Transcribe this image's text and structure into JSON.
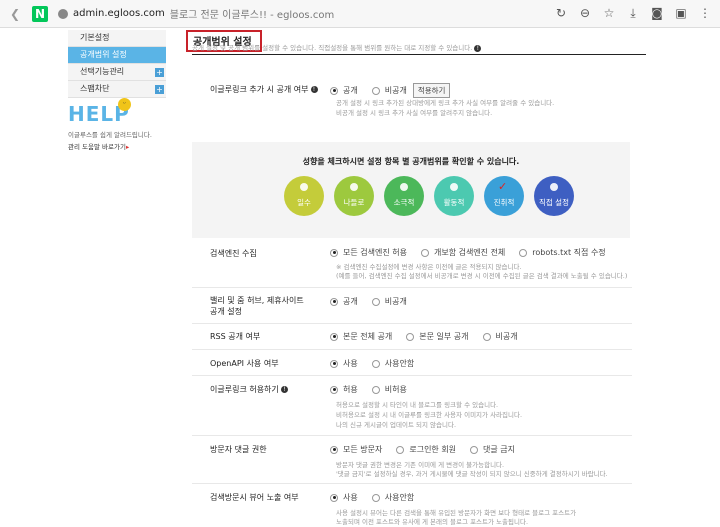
{
  "browser": {
    "logo_letter": "N",
    "url_domain": "admin.egloos.com",
    "url_title": "블로그 전문 이글루스!! - egloos.com"
  },
  "sidebar": {
    "items": [
      {
        "label": "기본설정",
        "active": false,
        "plus": false
      },
      {
        "label": "공개범위 설정",
        "active": true,
        "plus": false
      },
      {
        "label": "선택기능관리",
        "active": false,
        "plus": true
      },
      {
        "label": "스팸차단",
        "active": false,
        "plus": true
      }
    ],
    "plus_glyph": "+"
  },
  "help": {
    "title": "HELP",
    "smile": "ᵕ",
    "line1": "이글루스를 쉽게 알려드립니다.",
    "line2": "관리 도움말 바로가기",
    "arrow": "▸"
  },
  "main": {
    "title": "공개범위 설정",
    "desc": "공개 설정 및 공개 범위를 설정할 수 있습니다. 직접설정을 통해 범위를 원하는 대로 지정할 수 있습니다.",
    "trackback": {
      "label": "이글루링크 추가 시 공개 여부",
      "opt1": "공개",
      "opt2": "비공개",
      "apply": "적용하기",
      "note1": "공개 설정 시 링크 추가된 상대방에게 링크 추가 사실 여부를 알려줄 수 있습니다.",
      "note2": "비공개 설정 시 링크 추가 사실 여부를 알려주지 않습니다."
    },
    "persona": {
      "title": "성향을 체크하시면 설정 항목 별 공개범위를 확인할 수 있습니다.",
      "items": [
        {
          "label": "일수",
          "color": "#c4cc3a"
        },
        {
          "label": "나들로",
          "color": "#9dc93e"
        },
        {
          "label": "소극적",
          "color": "#4cb85a"
        },
        {
          "label": "활동적",
          "color": "#4cc9b0"
        },
        {
          "label": "진취적",
          "color": "#3aa0d8",
          "checked": true
        },
        {
          "label": "직접 설정",
          "color": "#3e5fc2"
        }
      ],
      "check_glyph": "✓"
    },
    "search": {
      "label": "검색엔진 수집",
      "opt1": "모든 검색엔진 허용",
      "opt2": "개보함 검색엔진 전체",
      "opt3": "robots.txt 직접 수정",
      "note1": "※ 검색엔진 수집설정에 변경 사항은 이전에 글은 적용되지 않습니다.",
      "note2": "(예를 들어, 검색엔진 수집 설정에서 비공개로 변경 시 이전에 수집된 글은 검색 결과에 노출될 수 있습니다.)"
    },
    "valley": {
      "label": "밸리 및 줌 허브, 제휴사이트",
      "label2": "공개 설정",
      "opt1": "공개",
      "opt2": "비공개"
    },
    "rss": {
      "label": "RSS 공개 여부",
      "opt1": "본문 전체 공개",
      "opt2": "본문 일부 공개",
      "opt3": "비공개"
    },
    "openapi": {
      "label": "OpenAPI 사용 여부",
      "opt1": "사용",
      "opt2": "사용안함"
    },
    "egloolink": {
      "label": "이글루링크 허용하기",
      "opt1": "허용",
      "opt2": "비허용",
      "note1": "허용으로 설정할 시 타인이 내 블로그를 링크할 수 있습니다.",
      "note2": "비허용으로 설정 시 내 이글루를 링크한 사용자 이미지가 사라집니다.",
      "note3": "나의 신규 게시글이 업데이트 되지 않습니다."
    },
    "comment": {
      "label": "방문자 댓글 권한",
      "opt1": "모든 방문자",
      "opt2": "로그인한 회원",
      "opt3": "댓글 금지",
      "note1": "방문자 댓글 권한 변경은 기존 이미에 게 변경이 불가능합니다.",
      "note2": "'댓글 금지'로 설정하실 경우, 과거 게시물에 댓글 작성이 되지 않으니 신중하게 결정하시기 바랍니다."
    },
    "searchvisitor": {
      "label": "검색방문시 뷰어 노출 여부",
      "opt1": "사용",
      "opt2": "사용안함",
      "note1": "사용 설정시 뷰어는 다른 검색을 통해 유입된 방문자가 화면 보다 형태로 블로그 포스트가",
      "note2": "노출되며 이전 포스트와 유사에 게 본래의 블로그 포스트가 노출됩니다."
    }
  }
}
